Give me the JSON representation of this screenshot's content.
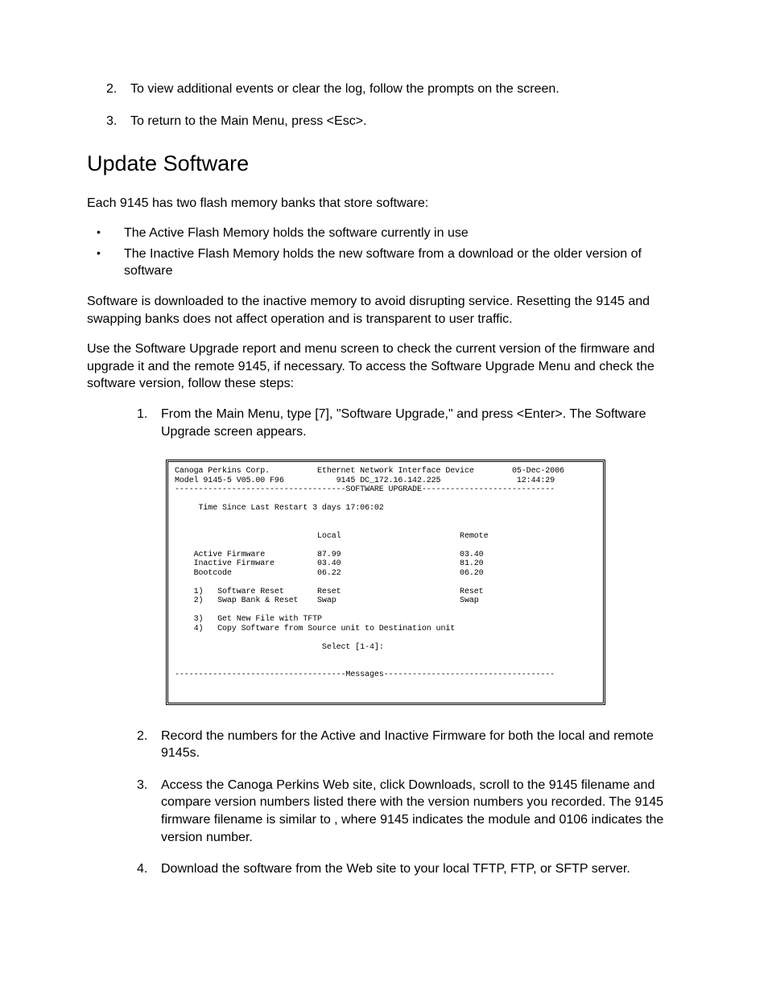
{
  "top_steps": {
    "s2_num": "2.",
    "s2_text": "To view additional events or clear the log, follow the prompts on the screen.",
    "s3_num": "3.",
    "s3_text": "To return to the Main Menu, press <Esc>."
  },
  "heading": "Update Software",
  "intro_p": "Each 9145 has two flash memory banks that store software:",
  "bullets": {
    "b1": "The Active Flash Memory holds the software currently in use",
    "b2": "The Inactive Flash Memory holds the new software from a download or the older version of software"
  },
  "para2": "Software is downloaded to the inactive memory to avoid disrupting service.  Resetting the 9145 and swapping banks does not affect operation and is transparent to user traffic.",
  "para3": "Use the Software Upgrade report and menu screen to check the current version of the firmware and upgrade it and the remote 9145, if necessary.  To access the Software Upgrade Menu and check the software version, follow these steps:",
  "steps_a": {
    "s1_num": "1.",
    "s1_text": "From the Main Menu, type [7], \"Software Upgrade,\" and press <Enter>.  The Software Upgrade screen appears."
  },
  "terminal": "Canoga Perkins Corp.          Ethernet Network Interface Device        05-Dec-2006\nModel 9145-5 V05.00 F96           9145 DC_172.16.142.225                12:44:29\n------------------------------------SOFTWARE UPGRADE----------------------------\n\n     Time Since Last Restart 3 days 17:06:02\n\n\n                              Local                         Remote\n\n    Active Firmware           87.99                         03.40\n    Inactive Firmware         03.40                         81.20\n    Bootcode                  06.22                         06.20\n\n    1)   Software Reset       Reset                         Reset\n    2)   Swap Bank & Reset    Swap                          Swap\n\n    3)   Get New File with TFTP\n    4)   Copy Software from Source unit to Destination unit\n\n                               Select [1-4]:\n\n\n------------------------------------Messages------------------------------------",
  "steps_b": {
    "s2_num": "2.",
    "s2_text": "Record the numbers for the Active and Inactive Firmware for both the local and remote 9145s.",
    "s3_num": "3.",
    "s3_text": "Access the Canoga Perkins Web site, click Downloads, scroll to the 9145 filename and compare version numbers listed there with the version numbers you recorded.  The 9145 firmware filename is similar to                        , where 9145 indicates the module and 0106 indicates the version number.",
    "s4_num": "4.",
    "s4_text": "Download the software from the Web site to your local TFTP, FTP, or SFTP server."
  }
}
